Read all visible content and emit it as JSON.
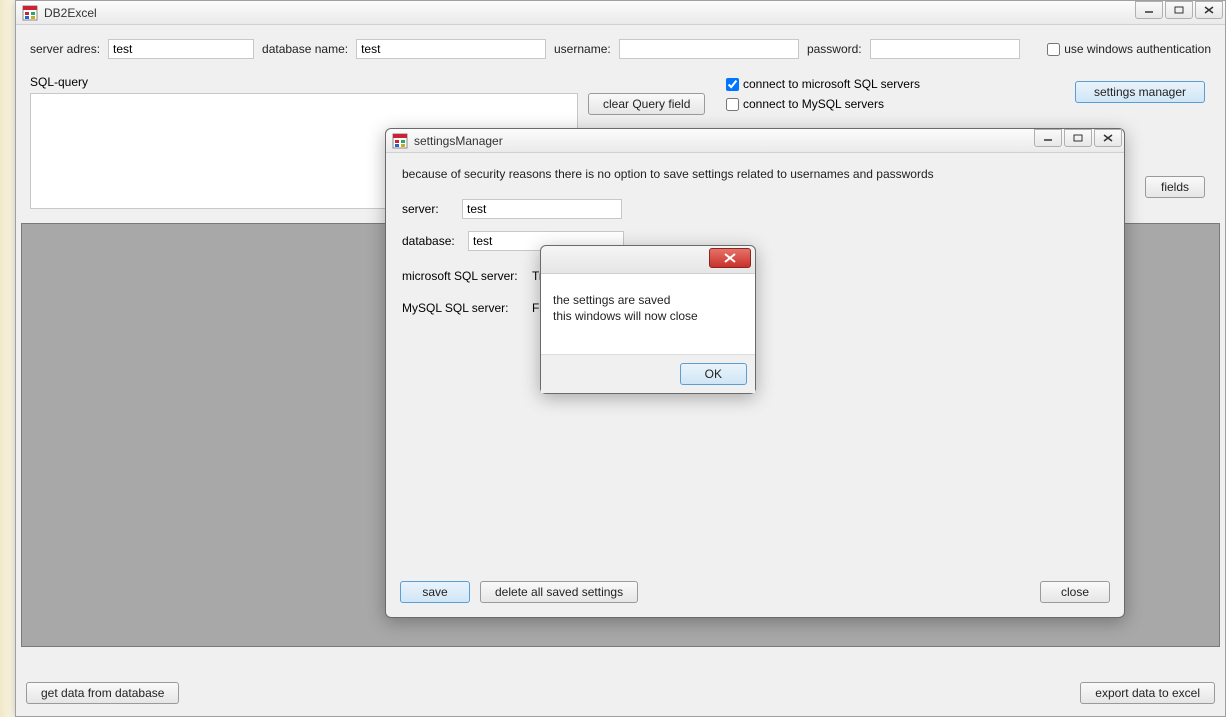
{
  "mainWindow": {
    "title": "DB2Excel",
    "labels": {
      "serverAdres": "server adres:",
      "databaseName": "database name:",
      "username": "username:",
      "password": "password:",
      "useWinAuth": "use windows authentication",
      "sqlQuery": "SQL-query",
      "connectMsSql": "connect to microsoft SQL  servers",
      "connectMySql": "connect to MySQL servers"
    },
    "values": {
      "serverAdres": "test",
      "databaseName": "test",
      "username": "",
      "password": "",
      "useWinAuth": false,
      "connectMsSql": true,
      "connectMySql": false,
      "sqlQuery": ""
    },
    "buttons": {
      "clearQuery": "clear Query field",
      "settingsManager": "settings manager",
      "fields": "fields",
      "getData": "get data from database",
      "exportExcel": "export data to excel"
    }
  },
  "settingsDialog": {
    "title": "settingsManager",
    "info": "because of security reasons there is no option to save settings related to usernames and passwords",
    "labels": {
      "server": "server:",
      "database": "database:",
      "msSqlServer": "microsoft SQL server:",
      "mySqlServer": "MySQL SQL server:"
    },
    "values": {
      "server": "test",
      "database": "test",
      "msSqlServer": "True",
      "mySqlServer": "False"
    },
    "buttons": {
      "save": "save",
      "deleteAll": "delete all saved settings",
      "close": "close"
    }
  },
  "messageBox": {
    "line1": "the settings are saved",
    "line2": " this windows will now close",
    "ok": "OK"
  }
}
